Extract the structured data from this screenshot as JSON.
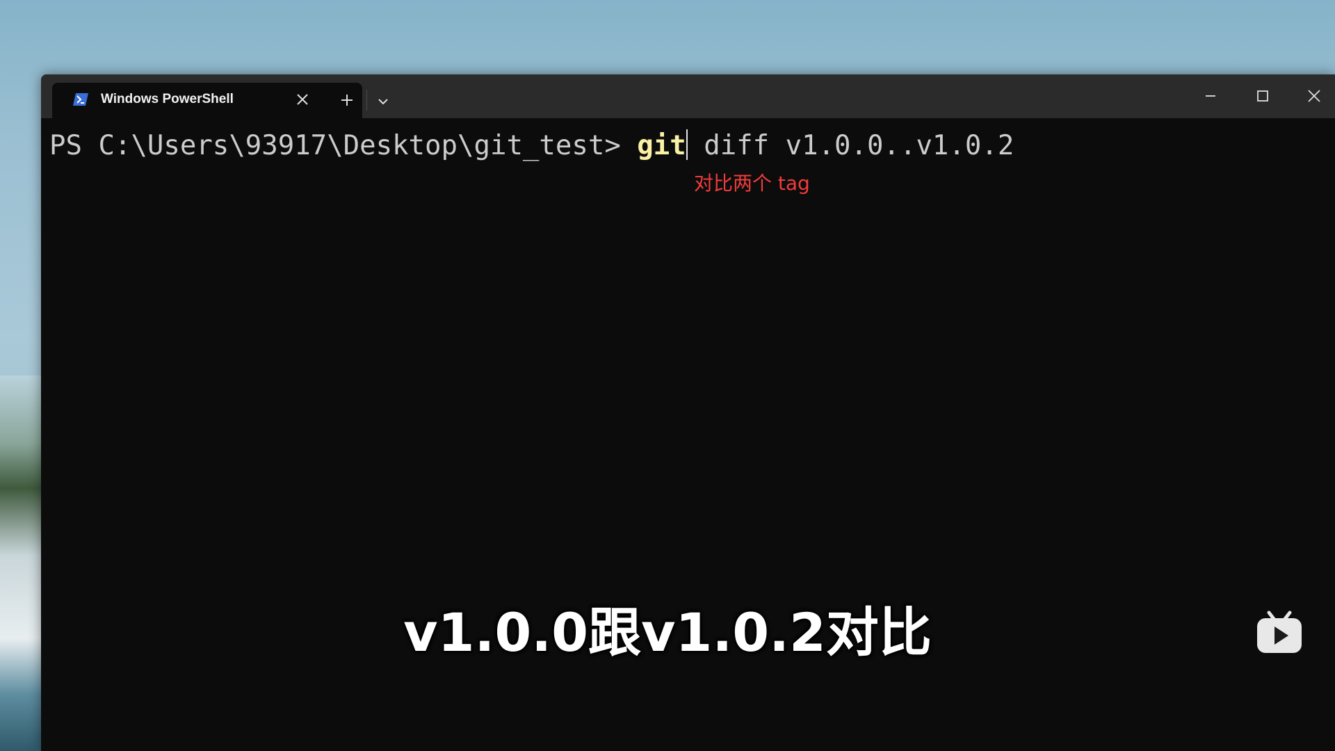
{
  "window": {
    "tab_title": "Windows PowerShell"
  },
  "terminal": {
    "prompt": "PS C:\\Users\\93917\\Desktop\\git_test> ",
    "command_git": "git",
    "command_rest": " diff v1.0.0..v1.0.2",
    "annotation": "对比两个 tag"
  },
  "subtitle": "v1.0.0跟v1.0.2对比",
  "icons": {
    "tab": "powershell-icon",
    "tab_close": "close-icon",
    "new_tab": "plus-icon",
    "dropdown": "chevron-down-icon",
    "minimize": "minimize-icon",
    "maximize": "maximize-icon",
    "close": "close-icon",
    "watermark": "bilibili-tv-icon"
  },
  "colors": {
    "terminal_bg": "#0c0c0c",
    "titlebar_bg": "#2b2b2b",
    "git_command": "#f9f1a5",
    "annotation": "#f03c3c"
  }
}
